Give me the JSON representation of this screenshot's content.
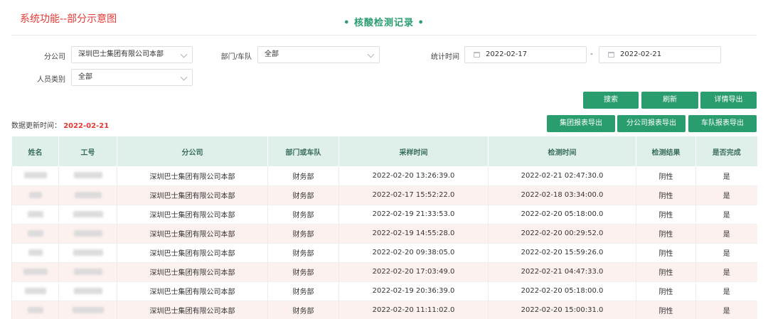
{
  "caption": "系统功能--部分示意图",
  "page_title": "• 核酸检测记录 •",
  "filters": {
    "company_label": "分公司",
    "company_value": "深圳巴士集团有限公司本部",
    "dept_label": "部门/车队",
    "dept_value": "全部",
    "stat_time_label": "统计时间",
    "date_start": "2022-02-17",
    "date_sep": "-",
    "date_end": "2022-02-21",
    "staff_type_label": "人员类别",
    "staff_type_value": "全部"
  },
  "buttons": {
    "search": "搜索",
    "refresh": "刷新",
    "detail_export": "详情导出",
    "group_export": "集团报表导出",
    "branch_export": "分公司报表导出",
    "team_export": "车队报表导出"
  },
  "update": {
    "label": "数据更新时间：",
    "value": "2022-02-21"
  },
  "accent_color": "#2a9d6f",
  "table": {
    "headers": [
      "姓名",
      "工号",
      "分公司",
      "部门或车队",
      "采样时间",
      "检测时间",
      "检测结果",
      "是否完成"
    ],
    "rows": [
      {
        "company": "深圳巴士集团有限公司本部",
        "dept": "财务部",
        "sample_time": "2022-02-20 13:26:39.0",
        "test_time": "2022-02-21 02:47:30.0",
        "result": "阴性",
        "done": "是"
      },
      {
        "company": "深圳巴士集团有限公司本部",
        "dept": "财务部",
        "sample_time": "2022-02-17 15:52:22.0",
        "test_time": "2022-02-18 03:34:00.0",
        "result": "阴性",
        "done": "是"
      },
      {
        "company": "深圳巴士集团有限公司本部",
        "dept": "财务部",
        "sample_time": "2022-02-19 21:33:53.0",
        "test_time": "2022-02-20 05:18:00.0",
        "result": "阴性",
        "done": "是"
      },
      {
        "company": "深圳巴士集团有限公司本部",
        "dept": "财务部",
        "sample_time": "2022-02-19 14:55:28.0",
        "test_time": "2022-02-20 00:29:52.0",
        "result": "阴性",
        "done": "是"
      },
      {
        "company": "深圳巴士集团有限公司本部",
        "dept": "财务部",
        "sample_time": "2022-02-20 09:38:05.0",
        "test_time": "2022-02-20 15:59:26.0",
        "result": "阴性",
        "done": "是"
      },
      {
        "company": "深圳巴士集团有限公司本部",
        "dept": "财务部",
        "sample_time": "2022-02-20 17:03:49.0",
        "test_time": "2022-02-21 04:47:33.0",
        "result": "阴性",
        "done": "是"
      },
      {
        "company": "深圳巴士集团有限公司本部",
        "dept": "财务部",
        "sample_time": "2022-02-19 20:36:39.0",
        "test_time": "2022-02-20 05:18:00.0",
        "result": "阴性",
        "done": "是"
      },
      {
        "company": "深圳巴士集团有限公司本部",
        "dept": "财务部",
        "sample_time": "2022-02-20 11:11:02.0",
        "test_time": "2022-02-20 15:00:31.0",
        "result": "阴性",
        "done": "是"
      }
    ]
  }
}
